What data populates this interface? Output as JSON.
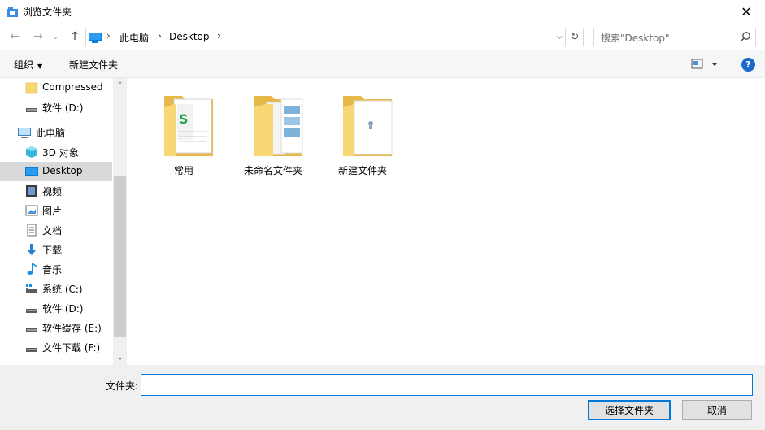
{
  "window": {
    "title": "浏览文件夹",
    "close_symbol": "✕"
  },
  "nav": {
    "back_symbol": "←",
    "forward_symbol": "→",
    "recent_symbol": "⌄",
    "up_symbol": "↑",
    "breadcrumbs": [
      "此电脑",
      "Desktop"
    ],
    "refresh_symbol": "↻",
    "search_placeholder": "搜索\"Desktop\""
  },
  "toolbar": {
    "organize_label": "组织",
    "new_folder_label": "新建文件夹",
    "help_symbol": "?"
  },
  "sidebar": {
    "items": [
      {
        "label": "Compressed",
        "icon": "folder-icon"
      },
      {
        "label": "软件 (D:)",
        "icon": "drive-icon"
      },
      {
        "label": "此电脑",
        "icon": "computer-icon"
      },
      {
        "label": "3D 对象",
        "icon": "3d-objects-icon"
      },
      {
        "label": "Desktop",
        "icon": "desktop-icon"
      },
      {
        "label": "视频",
        "icon": "video-icon"
      },
      {
        "label": "图片",
        "icon": "pictures-icon"
      },
      {
        "label": "文档",
        "icon": "documents-icon"
      },
      {
        "label": "下载",
        "icon": "download-icon"
      },
      {
        "label": "音乐",
        "icon": "music-icon"
      },
      {
        "label": "系统 (C:)",
        "icon": "system-drive-icon"
      },
      {
        "label": "软件 (D:)",
        "icon": "drive-icon"
      },
      {
        "label": "软件缓存 (E:)",
        "icon": "drive-icon"
      },
      {
        "label": "文件下载 (F:)",
        "icon": "drive-icon"
      }
    ],
    "selected_index": 4
  },
  "folders": [
    {
      "name": "常用"
    },
    {
      "name": "未命名文件夹"
    },
    {
      "name": "新建文件夹"
    }
  ],
  "bottom": {
    "folder_label": "文件夹:",
    "folder_value": "",
    "ok_label": "选择文件夹",
    "cancel_label": "取消"
  },
  "colors": {
    "accent": "#0078d7",
    "folder": "#f8d775",
    "selected_bg": "#d9d9d9"
  }
}
